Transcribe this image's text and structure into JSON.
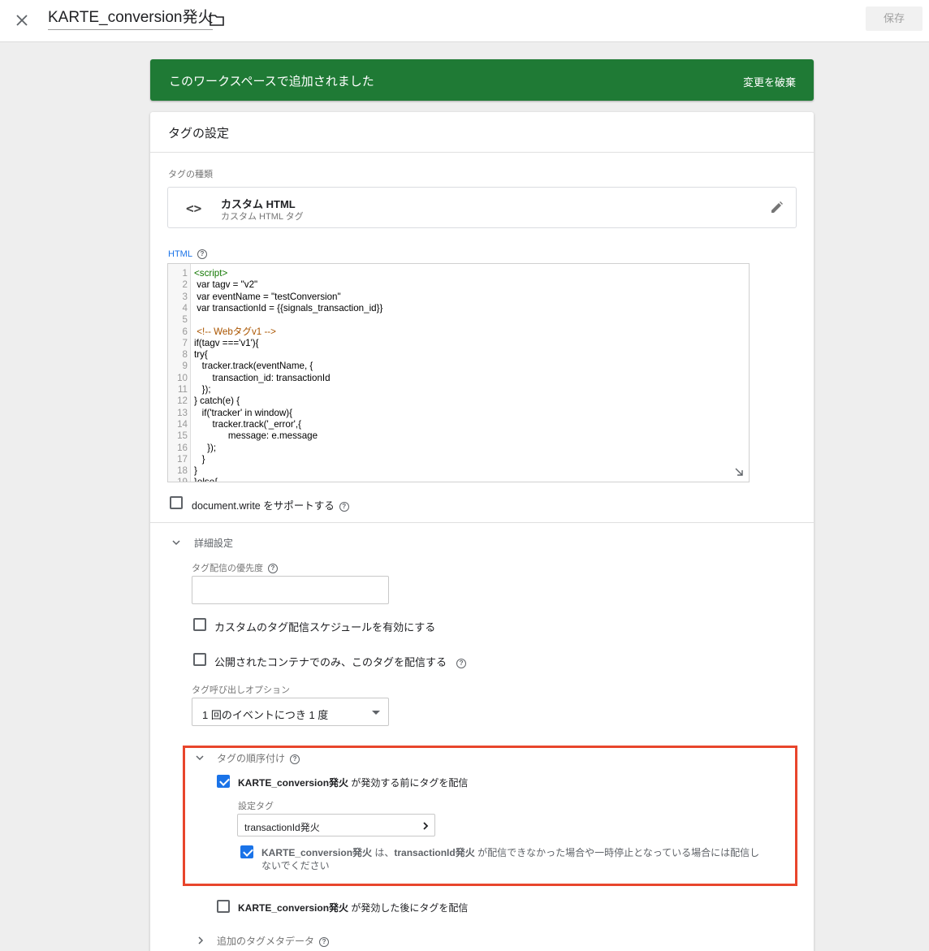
{
  "header": {
    "close_icon": "close-icon",
    "title": "KARTE_conversion発火",
    "folder_icon": "folder-icon",
    "save_label": "保存"
  },
  "banner": {
    "message": "このワークスペースで追加されました",
    "action": "変更を破棄",
    "color": "#1f7a35"
  },
  "card": {
    "title": "タグの設定",
    "tag_type_label": "タグの種類",
    "tag_type": {
      "name": "カスタム HTML",
      "description": "カスタム HTML タグ",
      "icon": "code-icon",
      "edit_icon": "pencil-icon"
    },
    "html_label": "HTML",
    "code_lines": [
      "<script>",
      " var tagv = \"v2\"",
      " var eventName = \"testConversion\"",
      " var transactionId = {{signals_transaction_id}}",
      "",
      " <!-- Webタグv1 -->",
      "if(tagv ==='v1'){",
      "try{",
      "   tracker.track(eventName, {",
      "       transaction_id: transactionId",
      "   });",
      "} catch(e) {",
      "   if('tracker' in window){",
      "       tracker.track('_error',{",
      "             message: e.message",
      "     });",
      "   }",
      "}",
      "}else{"
    ],
    "document_write_label": "document.write をサポートする",
    "advanced": {
      "title": "詳細設定",
      "priority_label": "タグ配信の優先度",
      "priority_value": "",
      "custom_schedule_label": "カスタムのタグ配信スケジュールを有効にする",
      "published_only_label": "公開されたコンテナでのみ、このタグを配信する",
      "firing_option_label": "タグ呼び出しオプション",
      "firing_option_value": "1 回のイベントにつき 1 度"
    },
    "sequencing": {
      "title": "タグの順序付け",
      "setup_tag_name": "KARTE_conversion発火",
      "setup_suffix": " が発効する前にタグを配信",
      "setup_checked": true,
      "setup_tag_label": "設定タグ",
      "setup_tag_value": "transactionId発火",
      "dont_fire_name": "KARTE_conversion発火",
      "dont_fire_mid1": " は、",
      "dont_fire_tag": "transactionId発火",
      "dont_fire_mid2": " が配信できなかった場合や一時停止となっている場合には配信し",
      "dont_fire_line2": "ないでください",
      "dont_fire_checked": true,
      "cleanup_tag_name": "KARTE_conversion発火",
      "cleanup_suffix": " が発効した後にタグを配信",
      "cleanup_checked": false
    },
    "metadata_label": "追加のタグメタデータ"
  }
}
